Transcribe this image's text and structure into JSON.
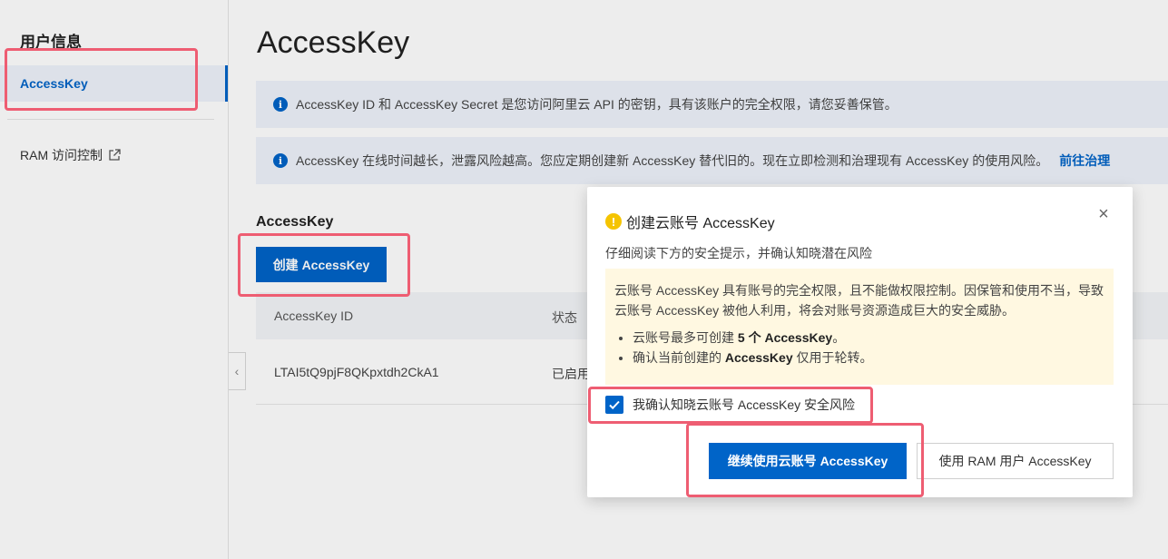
{
  "sidebar": {
    "title": "用户信息",
    "active_item": "AccessKey",
    "items": [
      {
        "label": "RAM 访问控制",
        "icon": "external-link-icon"
      }
    ]
  },
  "main": {
    "page_title": "AccessKey",
    "info_bars": [
      {
        "text": "AccessKey ID 和 AccessKey Secret 是您访问阿里云 API 的密钥，具有该账户的完全权限，请您妥善保管。",
        "icon": "info-icon"
      },
      {
        "text": "AccessKey 在线时间越长，泄露风险越高。您应定期创建新 AccessKey 替代旧的。现在立即检测和治理现有 AccessKey 的使用风险。",
        "link": "前往治理",
        "icon": "info-icon"
      }
    ],
    "section_title": "AccessKey",
    "create_button": "创建 AccessKey",
    "table": {
      "columns": [
        "AccessKey ID",
        "状态"
      ],
      "rows": [
        [
          "LTAI5tQ9pjF8QKpxtdh2CkA1",
          "已启用"
        ]
      ]
    }
  },
  "dialog": {
    "title": "创建云账号 AccessKey",
    "subtitle": "仔细阅读下方的安全提示，并确认知晓潜在风险",
    "notice_text": "云账号 AccessKey 具有账号的完全权限，且不能做权限控制。因保管和使用不当，导致云账号 AccessKey 被他人利用，将会对账号资源造成巨大的安全威胁。",
    "bullet1_pre": "云账号最多可创建 ",
    "bullet1_bold": "5 个 AccessKey",
    "bullet1_post": "。",
    "bullet2_pre": "确认当前创建的 ",
    "bullet2_bold": "AccessKey",
    "bullet2_post": " 仅用于轮转。",
    "checkbox_label": "我确认知晓云账号 AccessKey 安全风险",
    "checkbox_checked": true,
    "primary_button": "继续使用云账号 AccessKey",
    "secondary_button": "使用 RAM 用户 AccessKey"
  },
  "colors": {
    "accent": "#0064c8",
    "highlight": "#ee5d72",
    "warning": "#f5c400",
    "notice_bg": "#fff8e1"
  }
}
